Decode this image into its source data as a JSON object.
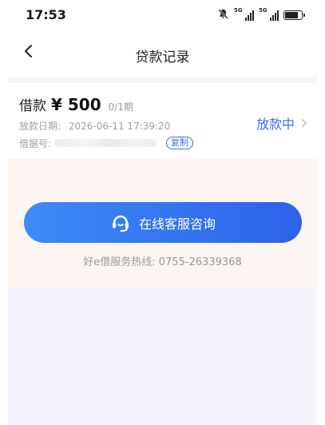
{
  "status_bar": {
    "time": "17:53",
    "signal_1_label": "5G",
    "signal_2_label": "5G",
    "icons": [
      "mute-bell-icon",
      "signal-5g-icon",
      "signal-5g-icon",
      "battery-icon"
    ],
    "battery_level": 0.8
  },
  "nav": {
    "back_icon": "chevron-left-icon",
    "title": "贷款记录"
  },
  "loan": {
    "label": "借款",
    "amount": "¥ 500",
    "period": "0/1期",
    "date_label": "放款日期:",
    "date_value": "2026-06-11 17:39:20",
    "id_label": "借据号:",
    "copy_label": "复制",
    "status": "放款中",
    "status_icon": "chevron-right-icon"
  },
  "consult": {
    "icon": "headset-icon",
    "label": "在线客服咨询"
  },
  "hotline": {
    "text": "好e借服务热线: 0755-26339368"
  },
  "colors": {
    "accent": "#3a6fe8",
    "button_gradient_start": "#3d8cf6",
    "button_gradient_end": "#2c62ea",
    "page_bg": "#f4f4fc",
    "pink_zone": "#fcf5f2"
  }
}
